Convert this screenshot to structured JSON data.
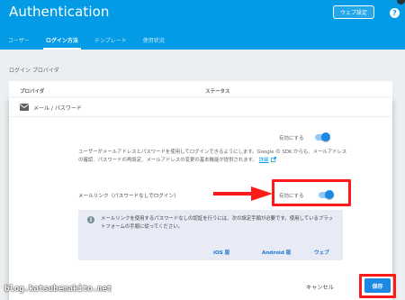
{
  "header": {
    "title": "Authentication",
    "web_settings_label": "ウェブ設定",
    "help_label": "?",
    "accent_color": "#039be5",
    "tabs": [
      {
        "label": "ユーザー",
        "active": false
      },
      {
        "label": "ログイン方法",
        "active": true
      },
      {
        "label": "テンプレート",
        "active": false
      },
      {
        "label": "使用状況",
        "active": false
      }
    ]
  },
  "providers": {
    "heading": "ログイン プロバイダ",
    "col_provider": "プロバイダ",
    "col_status": "ステータス"
  },
  "email_card": {
    "icon": "mail-icon",
    "title": "メール / パスワード",
    "enable_label": "有効にする",
    "enable_on": true,
    "description": "ユーザーがメールアドレスとパスワードを使用してログインできるようにします。Google の SDK からも、メールアドレスの確認、パスワードの再設定、メールアドレスの変更の基本機能が提供されます。",
    "learn_more": "詳細",
    "email_link_label": "メールリンク（パスワードなしでログイン）",
    "email_link_enable_label": "有効にする",
    "email_link_on": true,
    "info_text": "メールリンクを使用するパスワードなしの認証を行うには、次の設定手順が必要です。使用しているプラットフォームの手順に従ってください。",
    "platforms": [
      "iOS 版",
      "Android 版",
      "ウェブ"
    ]
  },
  "footer": {
    "cancel_label": "キャンセル",
    "save_label": "保存"
  },
  "watermark": "blog.katsubemakito.net",
  "highlight_color": "#ff1a1a"
}
